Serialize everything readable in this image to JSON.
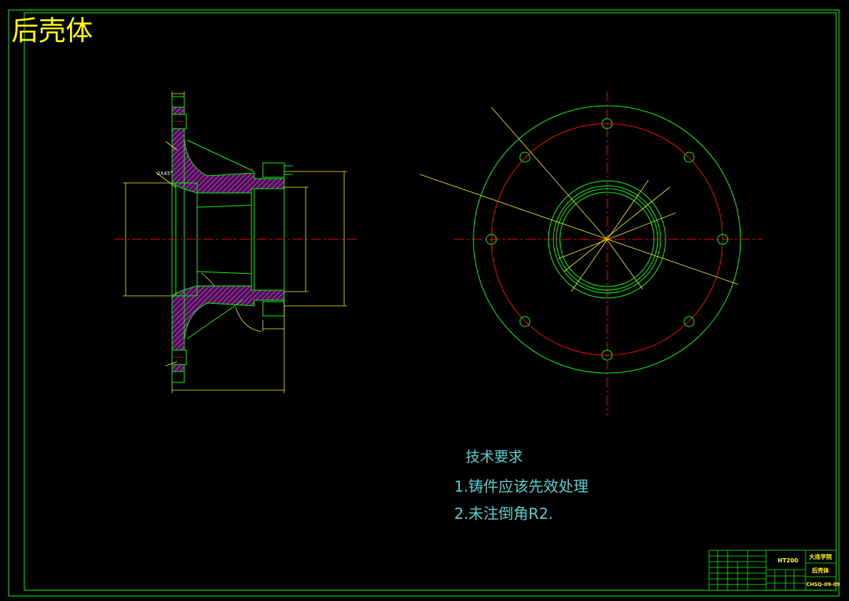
{
  "drawing": {
    "title": "后壳体",
    "notes_heading": "技术要求",
    "note_1": "1.铸件应该先效处理",
    "note_2": "2.未注倒角R2.",
    "chamfer_label": "2X45°",
    "material": "HT200",
    "school": "大连学院",
    "part_name": "后壳体",
    "drawing_number": "CHSQ-09-09"
  },
  "colors": {
    "background": "#000000",
    "border": "#00ff00",
    "centerline": "#ff0000",
    "hatch": "#b030c0",
    "dimension": "#ffff00",
    "outline": "#00ff00",
    "title_text": "#ffff00",
    "note_text": "#55d0d0"
  }
}
